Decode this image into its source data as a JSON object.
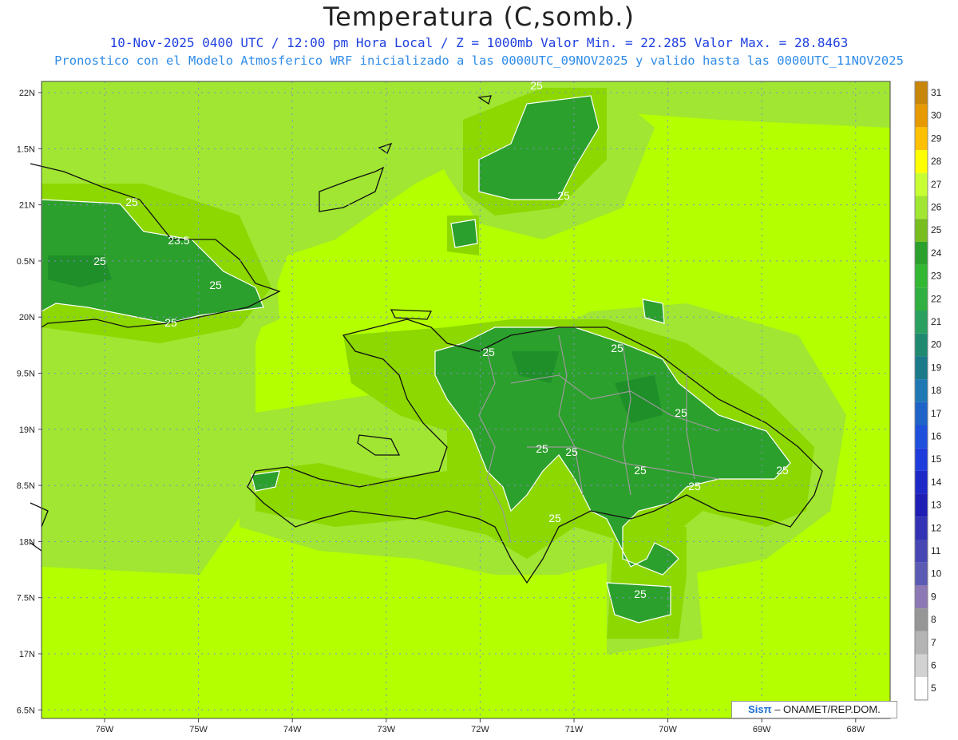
{
  "header": {
    "title": "Temperatura (C,somb.)",
    "line1": "10-Nov-2025 0400 UTC / 12:00 pm Hora Local / Z = 1000mb   Valor Min. = 22.285  Valor Max. = 28.8463",
    "line2": "Pronostico con el Modelo Atmosferico WRF inicializado a las 0000UTC_09NOV2025 y valido hasta las  0000UTC_11NOV2025"
  },
  "axes": {
    "lat_labels": [
      "22N",
      "1.5N",
      "21N",
      "0.5N",
      "20N",
      "9.5N",
      "19N",
      "8.5N",
      "18N",
      "7.5N",
      "17N",
      "6.5N"
    ],
    "lon_labels": [
      "76W",
      "75W",
      "74W",
      "73W",
      "72W",
      "71W",
      "70W",
      "69W",
      "68W"
    ]
  },
  "colorbar": {
    "labels": [
      "31",
      "30",
      "29",
      "28",
      "27",
      "26",
      "25",
      "24",
      "23",
      "22",
      "21",
      "20",
      "19",
      "18",
      "17",
      "16",
      "15",
      "14",
      "13",
      "12",
      "11",
      "10",
      "9",
      "8",
      "7",
      "6",
      "5"
    ],
    "colors": [
      "#c8860a",
      "#e69a00",
      "#ffc000",
      "#ffff00",
      "#c8ff32",
      "#a0e632",
      "#78be1e",
      "#2ca02c",
      "#33b833",
      "#30b040",
      "#2aa060",
      "#208a70",
      "#1a7a8a",
      "#1e78b4",
      "#1e64c8",
      "#1e50dc",
      "#1e3cdc",
      "#1e28c8",
      "#1e1eb4",
      "#3232b4",
      "#4646b4",
      "#5a5ab4",
      "#8c78b4",
      "#969696",
      "#b4b4b4",
      "#d2d2d2",
      "#ffffff"
    ]
  },
  "contour_labels": [
    "25",
    "25",
    "25",
    "23.5",
    "25",
    "25",
    "25",
    "25",
    "25",
    "25",
    "25",
    "25",
    "25",
    "25",
    "25",
    "25",
    "25"
  ],
  "credit": {
    "brand": "Sisπ",
    "text": " – ONAMET/REP.DOM."
  },
  "colors": {
    "sea_light": "#b4ff00",
    "land_mid": "#8cd800",
    "warm_green": "#78be1e",
    "dark_green": "#22a322",
    "contour": "#ffffff"
  }
}
